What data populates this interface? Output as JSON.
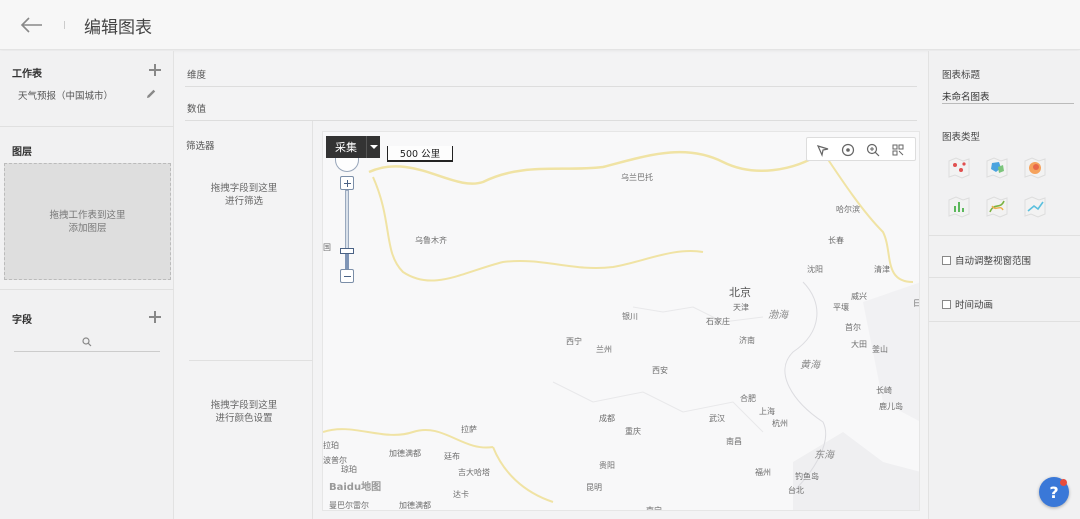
{
  "header": {
    "title": "编辑图表"
  },
  "left": {
    "worksheet_title": "工作表",
    "worksheet_item": "天气预报（中国城市）",
    "layer_title": "图层",
    "layer_drop_line1": "拖拽工作表到这里",
    "layer_drop_line2": "添加图层",
    "field_title": "字段"
  },
  "middle": {
    "shelf_dimension": "维度",
    "shelf_measure": "数值",
    "filter_title": "筛选器",
    "filter_drop_line1": "拖拽字段到这里",
    "filter_drop_line2": "进行筛选",
    "color_drop_line1": "拖拽字段到这里",
    "color_drop_line2": "进行颜色设置"
  },
  "map": {
    "capture_label": "采集",
    "scale_label": "500 公里",
    "watermark": "Baidu地图",
    "cities": [
      {
        "name": "乌兰巴托"
      },
      {
        "name": "乌鲁木齐"
      },
      {
        "name": "哈尔滨"
      },
      {
        "name": "长春"
      },
      {
        "name": "沈阳"
      },
      {
        "name": "清津"
      },
      {
        "name": "北京"
      },
      {
        "name": "天津"
      },
      {
        "name": "渤海"
      },
      {
        "name": "威兴"
      },
      {
        "name": "平壤"
      },
      {
        "name": "首尔"
      },
      {
        "name": "大田"
      },
      {
        "name": "釜山"
      },
      {
        "name": "石家庄"
      },
      {
        "name": "济南"
      },
      {
        "name": "银川"
      },
      {
        "name": "西宁"
      },
      {
        "name": "兰州"
      },
      {
        "name": "西安"
      },
      {
        "name": "黄海"
      },
      {
        "name": "合肥"
      },
      {
        "name": "上海"
      },
      {
        "name": "杭州"
      },
      {
        "name": "成都"
      },
      {
        "name": "武汉"
      },
      {
        "name": "重庆"
      },
      {
        "name": "南昌"
      },
      {
        "name": "长崎"
      },
      {
        "name": "鹿儿岛"
      },
      {
        "name": "拉萨"
      },
      {
        "name": "加德满都"
      },
      {
        "name": "廷布"
      },
      {
        "name": "吉大哈塔"
      },
      {
        "name": "达卡"
      },
      {
        "name": "贵阳"
      },
      {
        "name": "东海"
      },
      {
        "name": "福州"
      },
      {
        "name": "台北"
      },
      {
        "name": "钓鱼岛"
      },
      {
        "name": "昆明"
      },
      {
        "name": "南宁"
      },
      {
        "name": "拉珀"
      },
      {
        "name": "波普尔"
      },
      {
        "name": "琼珀"
      },
      {
        "name": "加德满都"
      },
      {
        "name": "曼巴尔雷尔"
      },
      {
        "name": "日"
      },
      {
        "name": "国"
      }
    ]
  },
  "right": {
    "chart_title_label": "图表标题",
    "chart_title_value": "未命名图表",
    "chart_type_label": "图表类型",
    "auto_zoom_label": "自动调整视窗范围",
    "time_anim_label": "时间动画"
  },
  "help": {
    "label": "?"
  },
  "colors": {
    "accent": "#3a78d8",
    "header_bg": "#f7f7f7",
    "panel_bg": "#f1f1f2"
  }
}
